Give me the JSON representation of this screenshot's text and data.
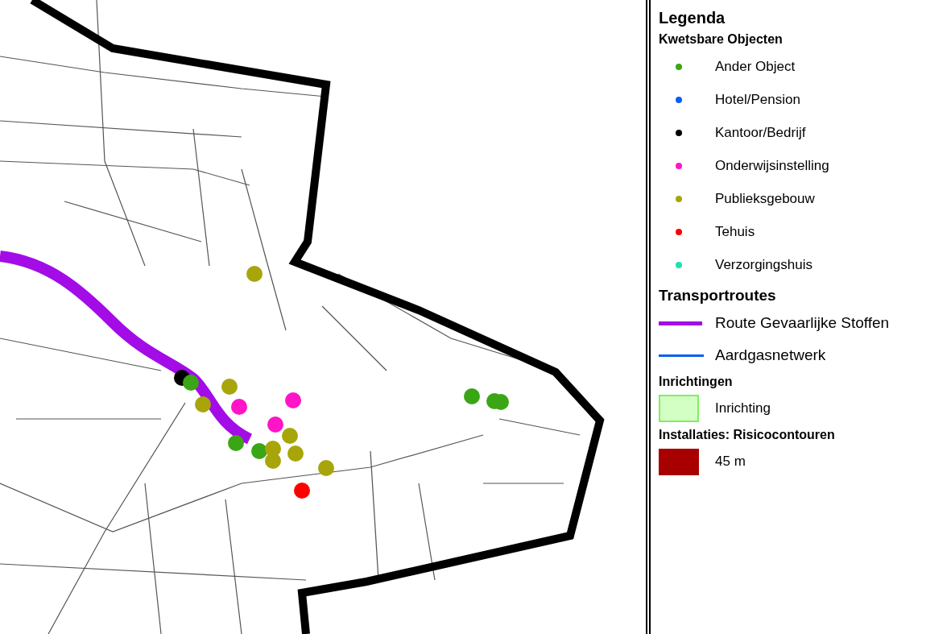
{
  "legend": {
    "title": "Legenda",
    "sections": [
      {
        "heading": "Kwetsbare Objecten",
        "items": [
          {
            "kind": "dot",
            "label": "Ander Object",
            "color": "#3aa616"
          },
          {
            "kind": "dot",
            "label": "Hotel/Pension",
            "color": "#0a5ff0"
          },
          {
            "kind": "dot",
            "label": "Kantoor/Bedrijf",
            "color": "#000000"
          },
          {
            "kind": "dot",
            "label": "Onderwijsinstelling",
            "color": "#ff14c8"
          },
          {
            "kind": "dot",
            "label": "Publieksgebouw",
            "color": "#a8a50a"
          },
          {
            "kind": "dot",
            "label": "Tehuis",
            "color": "#ff0000"
          },
          {
            "kind": "dot",
            "label": "Verzorgingshuis",
            "color": "#1de0b0"
          }
        ]
      },
      {
        "heading": "Transportroutes",
        "items": [
          {
            "kind": "thick-line",
            "label": "Route Gevaarlijke Stoffen",
            "color": "#a30ce6"
          },
          {
            "kind": "line",
            "label": "Aardgasnetwerk",
            "color": "#0a5ff0"
          }
        ]
      },
      {
        "heading": "Inrichtingen",
        "items": [
          {
            "kind": "area",
            "label": "Inrichting",
            "color": "#d4ffc4"
          }
        ]
      },
      {
        "heading": "Installaties: Risicocontouren",
        "items": [
          {
            "kind": "block",
            "label": "45 m",
            "color": "#a80000"
          }
        ]
      }
    ]
  }
}
